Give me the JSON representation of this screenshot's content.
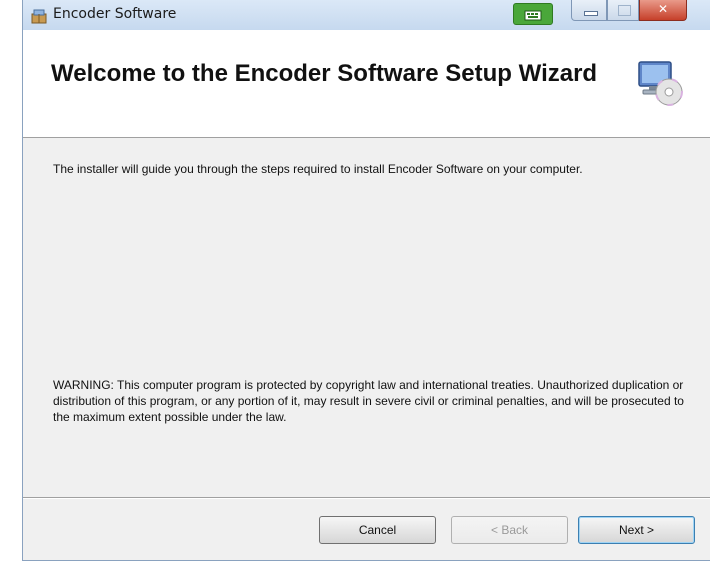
{
  "window": {
    "title": "Encoder Software"
  },
  "banner": {
    "title": "Welcome to the Encoder Software Setup Wizard"
  },
  "body": {
    "intro": "The installer will guide you through the steps required to install Encoder Software on your computer.",
    "warning": "WARNING: This computer program is protected by copyright law and international treaties. Unauthorized duplication or distribution of this program, or any portion of it, may result in severe civil or criminal penalties, and will be prosecuted to the maximum extent possible under the law."
  },
  "buttons": {
    "cancel": "Cancel",
    "back": "< Back",
    "next": "Next >"
  },
  "icons": {
    "app": "installer-box-icon",
    "banner": "computer-disc-icon",
    "language": "keyboard-language-icon",
    "close": "close-icon"
  },
  "colors": {
    "close_button": "#c6402a",
    "language_indicator": "#4aa73a",
    "next_focus": "#3c7fb1"
  }
}
